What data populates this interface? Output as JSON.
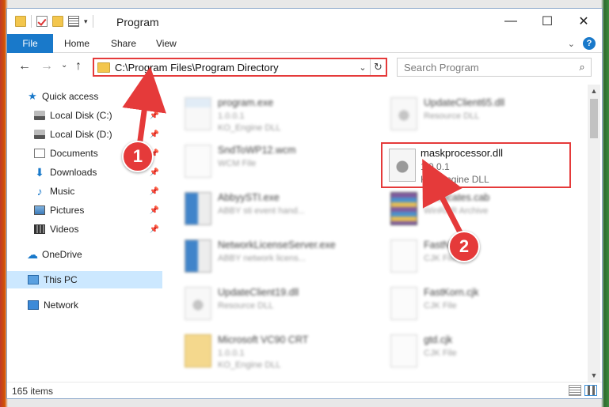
{
  "window": {
    "title": "Program",
    "controls": {
      "minimize": "—",
      "maximize": "☐",
      "close": "✕"
    }
  },
  "ribbon": {
    "tabs": [
      "File",
      "Home",
      "Share",
      "View"
    ],
    "help": "?"
  },
  "nav": {
    "back": "←",
    "forward": "→",
    "up_caret": "⌄",
    "up": "↑",
    "address": "C:\\Program Files\\Program Directory",
    "search_placeholder": "Search Program"
  },
  "sidebar": {
    "items": [
      {
        "label": "Quick access",
        "icon": "star-icon"
      },
      {
        "label": "Local Disk (C:)",
        "icon": "disk-icon",
        "pinned": true
      },
      {
        "label": "Local Disk (D:)",
        "icon": "disk-icon",
        "pinned": true
      },
      {
        "label": "Documents",
        "icon": "documents-icon",
        "pinned": true
      },
      {
        "label": "Downloads",
        "icon": "download-icon",
        "pinned": true
      },
      {
        "label": "Music",
        "icon": "music-icon",
        "pinned": true
      },
      {
        "label": "Pictures",
        "icon": "pictures-icon",
        "pinned": true
      },
      {
        "label": "Videos",
        "icon": "video-icon",
        "pinned": true
      },
      {
        "label": "OneDrive",
        "icon": "cloud-icon"
      },
      {
        "label": "This PC",
        "icon": "computer-icon",
        "selected": true
      },
      {
        "label": "Network",
        "icon": "network-icon"
      }
    ]
  },
  "files": {
    "left": [
      {
        "name": "program.exe",
        "line2": "1.0.0.1",
        "line3": "KO_Engine DLL",
        "icon": "exe"
      },
      {
        "name": "SndToWP12.wcm",
        "line2": "WCM File",
        "line3": "",
        "icon": "blank"
      },
      {
        "name": "AbbyySTI.exe",
        "line2": "ABBY sti event hand...",
        "line3": "",
        "icon": "app"
      },
      {
        "name": "NetworkLicenseServer.exe",
        "line2": "ABBY network licens...",
        "line3": "",
        "icon": "app"
      },
      {
        "name": "UpdateClient19.dll",
        "line2": "Resource DLL",
        "line3": "",
        "icon": "dll"
      },
      {
        "name": "Microsoft VC90 CRT",
        "line2": "1.0.0.1",
        "line3": "KO_Engine DLL",
        "icon": "blank"
      }
    ],
    "right": [
      {
        "name": "UpdateClient65.dll",
        "line2": "Resource DLL",
        "line3": "",
        "icon": "dll"
      },
      {
        "name": "certificates.cab",
        "line2": "WinRAR Archive",
        "line3": "",
        "icon": "rar"
      },
      {
        "name": "FastNim...",
        "line2": "CJK File",
        "line3": "",
        "icon": "blank"
      },
      {
        "name": "FastKorn.cjk",
        "line2": "CJK File",
        "line3": "",
        "icon": "blank"
      },
      {
        "name": "gtd.cjk",
        "line2": "CJK File",
        "line3": "",
        "icon": "blank"
      }
    ],
    "highlighted": {
      "name": "maskprocessor.dll",
      "line2": "1.0.0.1",
      "line3": "KO_Engine DLL"
    }
  },
  "status": {
    "count": "165 items"
  },
  "callouts": {
    "one": "1",
    "two": "2"
  },
  "colors": {
    "accent": "#1979ca",
    "highlight": "#e53a3a"
  }
}
